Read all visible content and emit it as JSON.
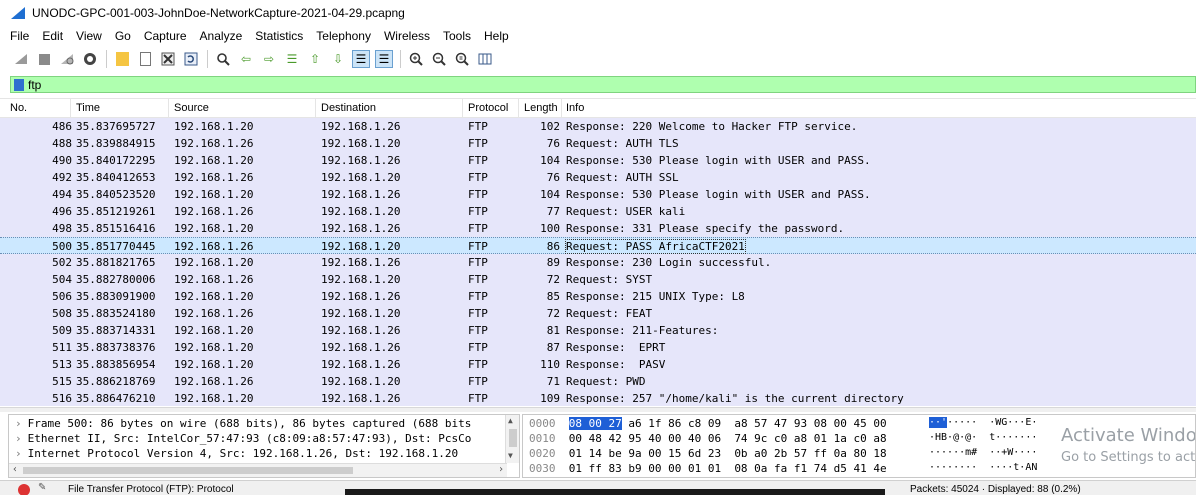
{
  "window": {
    "title": "UNODC-GPC-001-003-JohnDoe-NetworkCapture-2021-04-29.pcapng"
  },
  "menu": [
    "File",
    "Edit",
    "View",
    "Go",
    "Capture",
    "Analyze",
    "Statistics",
    "Telephony",
    "Wireless",
    "Tools",
    "Help"
  ],
  "toolbar_icons": [
    "shark-start-icon",
    "stop-icon",
    "restart-icon",
    "options-icon",
    "open-folder-icon",
    "file-icon",
    "close-file-icon",
    "reload-icon",
    "find-icon",
    "back-icon",
    "forward-icon",
    "goto-icon",
    "first-icon",
    "last-icon",
    "autoscroll-icon",
    "colorize-icon",
    "zoom-in-icon",
    "zoom-out-icon",
    "zoom-reset-icon",
    "resize-columns-icon"
  ],
  "filter": {
    "text": "ftp"
  },
  "columns": {
    "no": "No.",
    "time": "Time",
    "source": "Source",
    "destination": "Destination",
    "protocol": "Protocol",
    "length": "Length",
    "info": "Info"
  },
  "packets": [
    {
      "no": "486",
      "time": "35.837695727",
      "src": "192.168.1.20",
      "dst": "192.168.1.26",
      "proto": "FTP",
      "len": "102",
      "info": "Response: 220 Welcome to Hacker FTP service."
    },
    {
      "no": "488",
      "time": "35.839884915",
      "src": "192.168.1.26",
      "dst": "192.168.1.20",
      "proto": "FTP",
      "len": "76",
      "info": "Request: AUTH TLS"
    },
    {
      "no": "490",
      "time": "35.840172295",
      "src": "192.168.1.20",
      "dst": "192.168.1.26",
      "proto": "FTP",
      "len": "104",
      "info": "Response: 530 Please login with USER and PASS."
    },
    {
      "no": "492",
      "time": "35.840412653",
      "src": "192.168.1.26",
      "dst": "192.168.1.20",
      "proto": "FTP",
      "len": "76",
      "info": "Request: AUTH SSL"
    },
    {
      "no": "494",
      "time": "35.840523520",
      "src": "192.168.1.20",
      "dst": "192.168.1.26",
      "proto": "FTP",
      "len": "104",
      "info": "Response: 530 Please login with USER and PASS."
    },
    {
      "no": "496",
      "time": "35.851219261",
      "src": "192.168.1.26",
      "dst": "192.168.1.20",
      "proto": "FTP",
      "len": "77",
      "info": "Request: USER kali"
    },
    {
      "no": "498",
      "time": "35.851516416",
      "src": "192.168.1.20",
      "dst": "192.168.1.26",
      "proto": "FTP",
      "len": "100",
      "info": "Response: 331 Please specify the password."
    },
    {
      "no": "500",
      "time": "35.851770445",
      "src": "192.168.1.26",
      "dst": "192.168.1.20",
      "proto": "FTP",
      "len": "86",
      "info": "Request: PASS AfricaCTF2021",
      "selected": true
    },
    {
      "no": "502",
      "time": "35.881821765",
      "src": "192.168.1.20",
      "dst": "192.168.1.26",
      "proto": "FTP",
      "len": "89",
      "info": "Response: 230 Login successful."
    },
    {
      "no": "504",
      "time": "35.882780006",
      "src": "192.168.1.26",
      "dst": "192.168.1.20",
      "proto": "FTP",
      "len": "72",
      "info": "Request: SYST"
    },
    {
      "no": "506",
      "time": "35.883091900",
      "src": "192.168.1.20",
      "dst": "192.168.1.26",
      "proto": "FTP",
      "len": "85",
      "info": "Response: 215 UNIX Type: L8"
    },
    {
      "no": "508",
      "time": "35.883524180",
      "src": "192.168.1.26",
      "dst": "192.168.1.20",
      "proto": "FTP",
      "len": "72",
      "info": "Request: FEAT"
    },
    {
      "no": "509",
      "time": "35.883714331",
      "src": "192.168.1.20",
      "dst": "192.168.1.26",
      "proto": "FTP",
      "len": "81",
      "info": "Response: 211-Features:"
    },
    {
      "no": "511",
      "time": "35.883738376",
      "src": "192.168.1.20",
      "dst": "192.168.1.26",
      "proto": "FTP",
      "len": "87",
      "info": "Response:  EPRT"
    },
    {
      "no": "513",
      "time": "35.883856954",
      "src": "192.168.1.20",
      "dst": "192.168.1.26",
      "proto": "FTP",
      "len": "110",
      "info": "Response:  PASV"
    },
    {
      "no": "515",
      "time": "35.886218769",
      "src": "192.168.1.26",
      "dst": "192.168.1.20",
      "proto": "FTP",
      "len": "71",
      "info": "Request: PWD"
    },
    {
      "no": "516",
      "time": "35.886476210",
      "src": "192.168.1.20",
      "dst": "192.168.1.26",
      "proto": "FTP",
      "len": "109",
      "info": "Response: 257 \"/home/kali\" is the current directory"
    }
  ],
  "details": [
    "Frame 500: 86 bytes on wire (688 bits), 86 bytes captured (688 bits",
    "Ethernet II, Src: IntelCor_57:47:93 (c8:09:a8:57:47:93), Dst: PcsCo",
    "Internet Protocol Version 4, Src: 192.168.1.26, Dst: 192.168.1.20",
    "File Transfer Protocol (FTP): Protocol"
  ],
  "hex": [
    {
      "off": "0000",
      "hl": "08 00 27",
      "rest": " a6 1f 86 c8 09  a8 57 47 93 08 00 45 00",
      "ascii_hl": "··'",
      "ascii": "·····  ·WG···E·"
    },
    {
      "off": "0010",
      "hl": "",
      "rest": "00 48 42 95 40 00 40 06  74 9c c0 a8 01 1a c0 a8",
      "ascii_hl": "",
      "ascii": "·HB·@·@·  t·······"
    },
    {
      "off": "0020",
      "hl": "",
      "rest": "01 14 be 9a 00 15 6d 23  0b a0 2b 57 ff 0a 80 18",
      "ascii_hl": "",
      "ascii": "······m#  ··+W····"
    },
    {
      "off": "0030",
      "hl": "",
      "rest": "01 ff 83 b9 00 00 01 01  08 0a fa f1 74 d5 41 4e",
      "ascii_hl": "",
      "ascii": "········  ····t·AN"
    }
  ],
  "watermark": {
    "line1": "Activate Windo",
    "line2": "Go to Settings to act"
  },
  "status": {
    "left": "File Transfer Protocol (FTP): Protocol",
    "right": "Packets: 45024 · Displayed: 88 (0.2%)"
  }
}
